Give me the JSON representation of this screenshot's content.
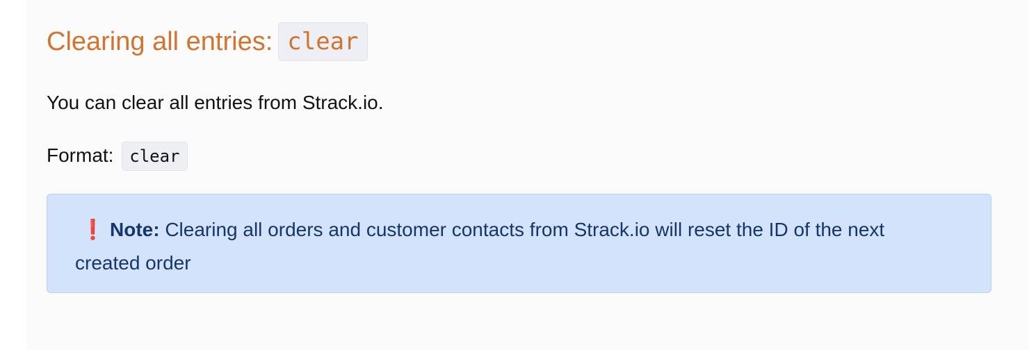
{
  "section": {
    "title": "Clearing all entries:",
    "title_code": "clear",
    "description": "You can clear all entries from Strack.io.",
    "format_label": "Format:",
    "format_code": "clear"
  },
  "note": {
    "icon": "exclamation-icon",
    "icon_glyph": "❗",
    "label": "Note:",
    "text": " Clearing all orders and customer contacts from Strack.io will reset the ID of the next created order"
  },
  "colors": {
    "heading": "#d2742f",
    "note_background": "#d3e3fb",
    "note_text": "#15356c",
    "alert": "#d8262b"
  }
}
